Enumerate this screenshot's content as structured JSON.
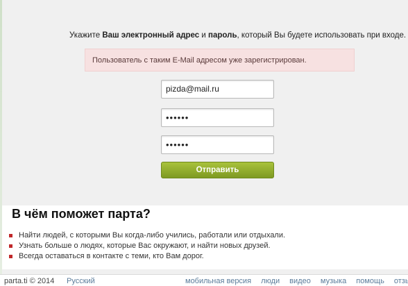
{
  "form": {
    "prompt_prefix": "Укажите ",
    "prompt_email": "Ваш электронный адрес",
    "prompt_and": " и ",
    "prompt_password": "пароль",
    "prompt_suffix": ", который Вы будете использовать при входе.",
    "error_message": "Пользователь с таким E-Mail адресом уже зарегистрирован.",
    "email_value": "pizda@mail.ru",
    "password_value": "••••••",
    "password_confirm_value": "••••••",
    "submit_label": "Отправить"
  },
  "info": {
    "title": "В чём поможет парта?",
    "bullets": [
      "Найти людей, с которыми Вы когда-либо учились, работали или отдыхали.",
      "Узнать больше о людях, которые Вас окружают, и найти новых друзей.",
      "Всегда оставаться в контакте с теми, кто Вам дорог."
    ]
  },
  "footer": {
    "copyright": "parta.ti © 2014",
    "language": "Русский",
    "links": [
      "мобильная версия",
      "люди",
      "видео",
      "музыка",
      "помощь",
      "отзывы"
    ]
  },
  "colors": {
    "button": "#8fab2c",
    "alert_bg": "#f7e1e1",
    "bullet": "#c0282a",
    "link": "#5a7b9a"
  }
}
